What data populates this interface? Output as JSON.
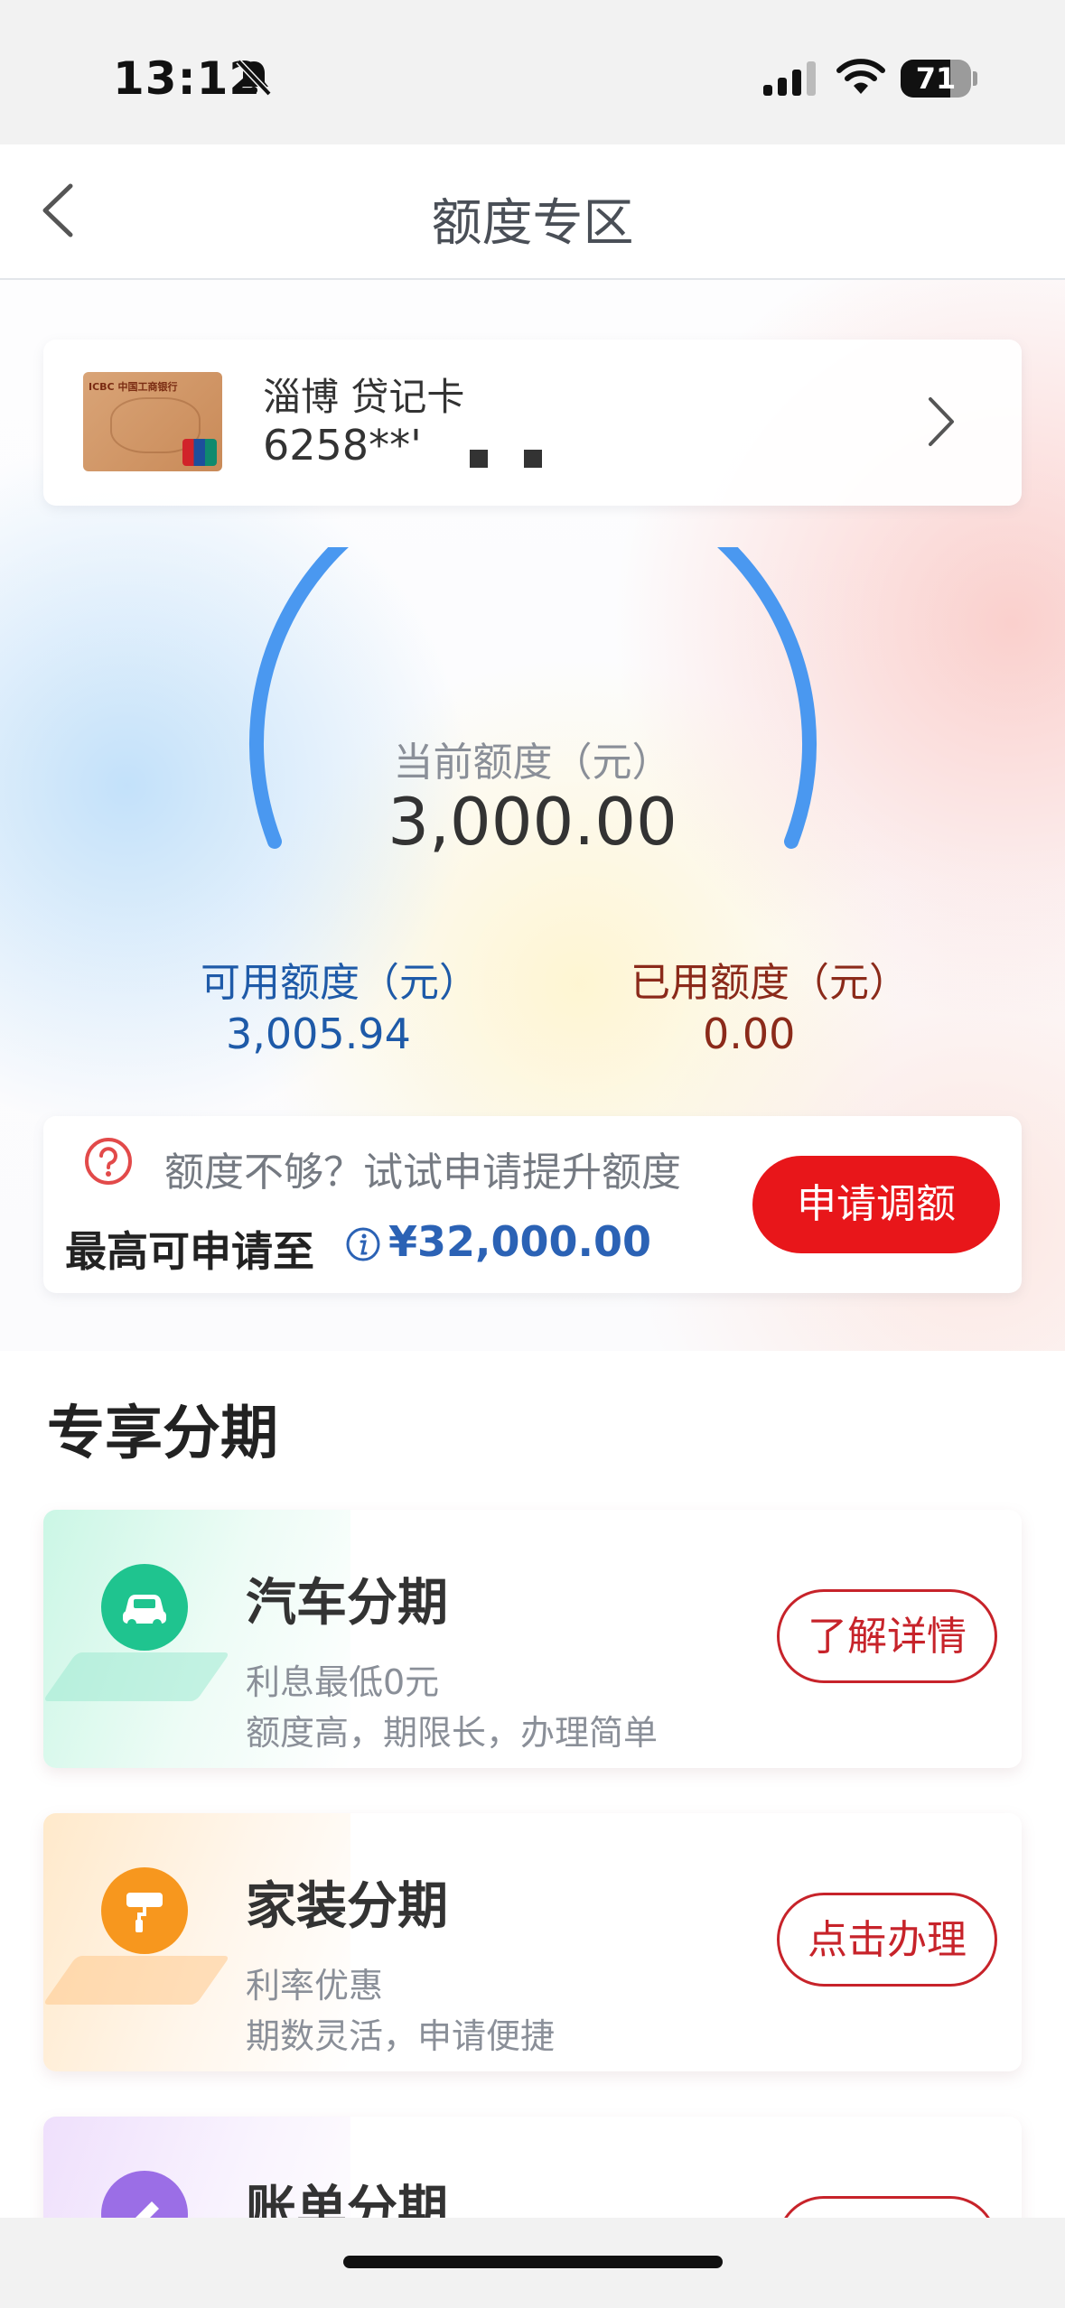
{
  "status_bar": {
    "time": "13:12",
    "battery": "71",
    "battery_level": 0.71
  },
  "nav": {
    "title": "额度专区"
  },
  "card": {
    "name": "淄博 贷记卡",
    "number": "6258**'",
    "bank_text": "ICBC 中国工商银行"
  },
  "limits": {
    "current_label": "当前额度（元）",
    "current_value": "3,000.00",
    "available_label": "可用额度（元）",
    "available_value": "3,005.94",
    "used_label": "已用额度（元）",
    "used_value": "0.00"
  },
  "promo": {
    "question": "额度不够？试试申请提升额度",
    "max_label": "最高可申请至",
    "max_value": "¥32,000.00",
    "apply_button": "申请调额"
  },
  "installments": {
    "title": "专享分期",
    "items": [
      {
        "title": "汽车分期",
        "sub1": "利息最低0元",
        "sub2": "额度高，期限长，办理简单",
        "button": "了解详情",
        "icon": "car-icon",
        "color": "#1fc48f"
      },
      {
        "title": "家装分期",
        "sub1": "利率优惠",
        "sub2": "期数灵活，申请便捷",
        "button": "点击办理",
        "icon": "paint-roller-icon",
        "color": "#f7971e"
      },
      {
        "title": "账单分期",
        "sub1": "",
        "sub2": "",
        "button": "",
        "icon": "pencil-icon",
        "color": "#9b6ee6"
      }
    ]
  },
  "colors": {
    "accent_red": "#e8161a",
    "gauge_blue": "#4a98f0",
    "available_blue": "#1e5aa8",
    "used_brown": "#8b2a1a"
  }
}
